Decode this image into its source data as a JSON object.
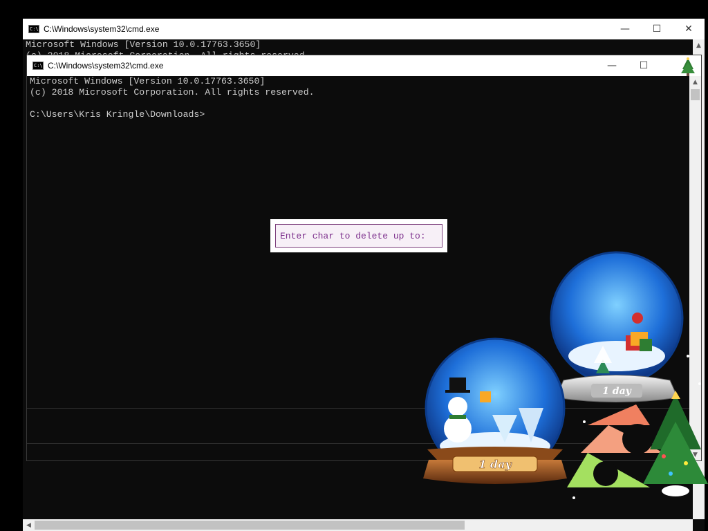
{
  "back_window": {
    "title": "C:\\Windows\\system32\\cmd.exe",
    "lines": [
      "Microsoft Windows [Version 10.0.17763.3650]",
      "(c) 2018 Microsoft Corporation. All rights reserved."
    ]
  },
  "front_window": {
    "title": "C:\\Windows\\system32\\cmd.exe",
    "lines": [
      "Microsoft Windows [Version 10.0.17763.3650]",
      "(c) 2018 Microsoft Corporation. All rights reserved.",
      "",
      "C:\\Users\\Kris Kringle\\Downloads>"
    ]
  },
  "dialog": {
    "prompt": "Enter char to delete up to:"
  },
  "window_controls": {
    "minimize": "—",
    "maximize": "☐",
    "close": "✕"
  },
  "snowglobes": {
    "left_label": "1 day",
    "right_label": "1 day"
  },
  "colors": {
    "console_bg": "#0c0c0c",
    "console_text": "#cccccc",
    "dialog_text": "#7c2f8c",
    "dialog_border": "#7a3c7a"
  },
  "icons": {
    "window_icon": "cmd-window-icon",
    "scroll_left": "scroll-left-arrow-icon",
    "scroll_up": "scroll-up-arrow-icon"
  }
}
